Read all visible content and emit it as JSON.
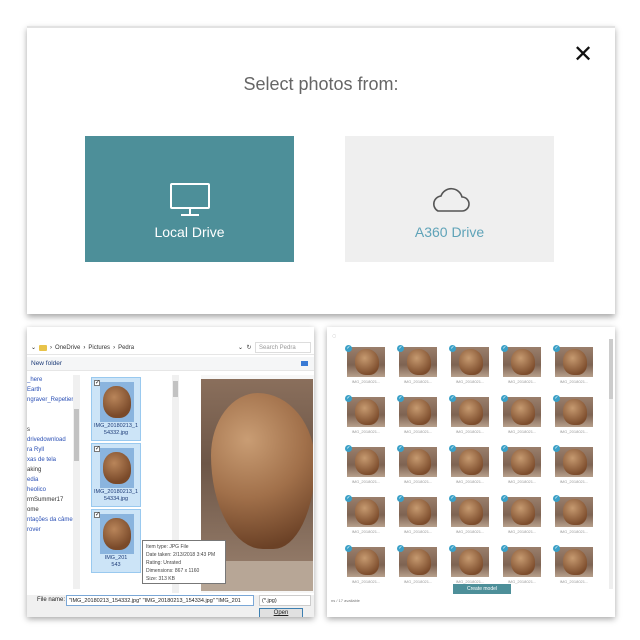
{
  "dialog": {
    "title": "Select photos from:",
    "close_glyph": "✕",
    "options": [
      {
        "label": "Local Drive",
        "icon": "monitor-icon"
      },
      {
        "label": "A360 Drive",
        "icon": "cloud-icon"
      }
    ]
  },
  "explorer": {
    "path": [
      "OneDrive",
      "Pictures",
      "Pedra"
    ],
    "search_placeholder": "Search Pedra",
    "new_folder": "New folder",
    "nav_items": [
      {
        "label": "_here",
        "dark": false
      },
      {
        "label": "Earth",
        "dark": false
      },
      {
        "label": "ngraver_Repetier",
        "dark": false
      },
      {
        "label": "",
        "dark": false
      },
      {
        "label": "",
        "dark": false
      },
      {
        "label": "s",
        "dark": true
      },
      {
        "label": "drivedownload",
        "dark": false
      },
      {
        "label": "ra Ryll",
        "dark": false
      },
      {
        "label": "xas de tela",
        "dark": false
      },
      {
        "label": "aking",
        "dark": true
      },
      {
        "label": "edia",
        "dark": false
      },
      {
        "label": "heolico",
        "dark": false
      },
      {
        "label": "rmSummer17",
        "dark": true
      },
      {
        "label": "ome",
        "dark": true
      },
      {
        "label": "ntações da câmera",
        "dark": false
      },
      {
        "label": "rover",
        "dark": false
      }
    ],
    "files": [
      {
        "name": "IMG_20180213_154332.jpg",
        "name_lines": [
          "IMG_20180213_1",
          "54332.jpg"
        ]
      },
      {
        "name": "IMG_20180213_154334.jpg",
        "name_lines": [
          "IMG_20180213_1",
          "54334.jpg"
        ]
      },
      {
        "name": "IMG_20180213_1543",
        "name_lines": [
          "IMG_201",
          "543"
        ]
      }
    ],
    "tooltip": [
      "Item type: JPG File",
      "Date taken: 2/13/2018 3:43 PM",
      "Rating: Unrated",
      "Dimensions: 867 x 1160",
      "Size: 313 KB"
    ],
    "footer": {
      "file_name_label": "File name:",
      "file_name_value": "\"IMG_20180213_154332.jpg\" \"IMG_20180213_154334.jpg\" \"IMG_201",
      "filter": "(*.jpg)",
      "open_label": "Open"
    }
  },
  "grid": {
    "caption": "IMG_2018021...",
    "rows": 5,
    "cols": 5,
    "status": "ns / 17 available",
    "create_label": "Create model",
    "accent": "#4d8f99",
    "check_color": "#3aa0c7"
  }
}
